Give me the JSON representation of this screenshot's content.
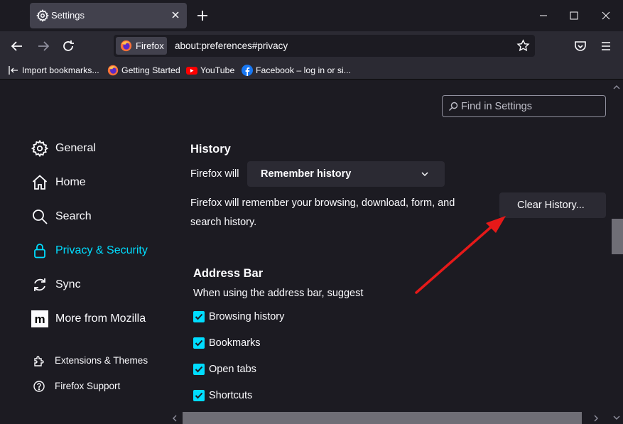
{
  "tab": {
    "title": "Settings"
  },
  "urlbar": {
    "identity_label": "Firefox",
    "url": "about:preferences#privacy"
  },
  "bookmarks": [
    {
      "label": "Import bookmarks...",
      "icon": "import-icon"
    },
    {
      "label": "Getting Started",
      "icon": "firefox-icon"
    },
    {
      "label": "YouTube",
      "icon": "youtube-icon"
    },
    {
      "label": "Facebook – log in or si...",
      "icon": "facebook-icon"
    }
  ],
  "search": {
    "placeholder": "Find in Settings"
  },
  "sidebar": {
    "items": [
      {
        "label": "General",
        "icon": "gear-icon"
      },
      {
        "label": "Home",
        "icon": "home-icon"
      },
      {
        "label": "Search",
        "icon": "search-icon"
      },
      {
        "label": "Privacy & Security",
        "icon": "lock-icon",
        "active": true
      },
      {
        "label": "Sync",
        "icon": "sync-icon"
      },
      {
        "label": "More from Mozilla",
        "icon": "mozilla-icon"
      }
    ],
    "footer": [
      {
        "label": "Extensions & Themes",
        "icon": "puzzle-icon"
      },
      {
        "label": "Firefox Support",
        "icon": "help-icon"
      }
    ]
  },
  "history": {
    "title": "History",
    "will_label": "Firefox will",
    "mode_value": "Remember history",
    "description_line1": "Firefox will remember your browsing, download, form, and",
    "description_line2": "search history.",
    "clear_button": "Clear History..."
  },
  "address_bar": {
    "title": "Address Bar",
    "subtitle": "When using the address bar, suggest",
    "options": [
      {
        "label": "Browsing history",
        "checked": true
      },
      {
        "label": "Bookmarks",
        "checked": true
      },
      {
        "label": "Open tabs",
        "checked": true
      },
      {
        "label": "Shortcuts",
        "checked": true
      }
    ]
  },
  "colors": {
    "accent": "#00ddff",
    "annotation_arrow": "#e61919",
    "background": "#1c1b22"
  }
}
